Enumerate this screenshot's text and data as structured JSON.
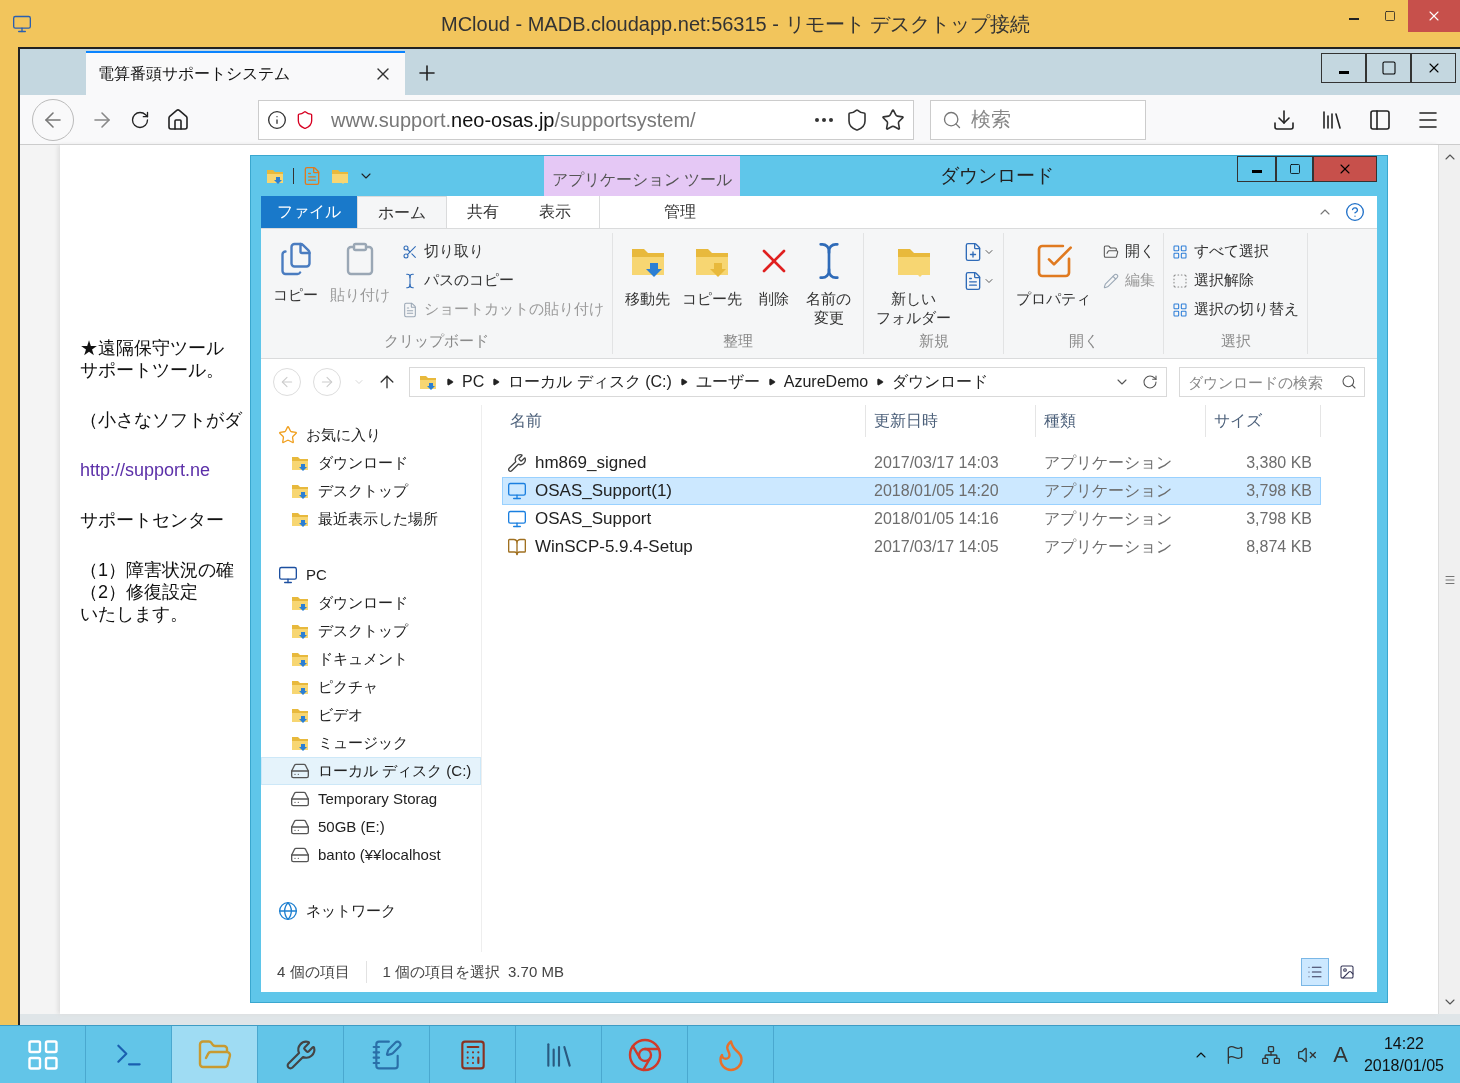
{
  "rdp": {
    "title": "MCloud - MADB.cloudapp.net:56315 - リモート デスクトップ接続"
  },
  "browser": {
    "tabs": [
      {
        "label": "電算番頭サポートシステム",
        "selected": true
      }
    ],
    "url": {
      "prefix": "www.support.",
      "domain": "neo-osas.jp",
      "path": "/supportsystem/"
    },
    "search": {
      "placeholder": "検索"
    }
  },
  "page": {
    "paragraphs": [
      {
        "kind": "text",
        "lines": [
          "★遠隔保守ツール",
          "サポートツール。"
        ]
      },
      {
        "kind": "text",
        "lines": [
          "（小さなソフトがダ"
        ]
      },
      {
        "kind": "link",
        "lines": [
          "http://support.ne"
        ]
      },
      {
        "kind": "text",
        "lines": [
          "サポートセンター"
        ]
      },
      {
        "kind": "text",
        "lines": [
          "（1）障害状況の確",
          "（2）修復設定",
          "いたします。"
        ]
      }
    ]
  },
  "explorer": {
    "title": "ダウンロード",
    "context_tab": "アプリケーション ツール",
    "ribbon_tabs": [
      {
        "label": "ファイル",
        "kind": "file",
        "selected": false
      },
      {
        "label": "ホーム",
        "kind": "tab",
        "selected": true
      },
      {
        "label": "共有",
        "kind": "tab",
        "selected": false
      },
      {
        "label": "表示",
        "kind": "tab",
        "selected": false
      },
      {
        "label": "管理",
        "kind": "context",
        "selected": false
      }
    ],
    "ribbon_groups": [
      {
        "label": "クリップボード",
        "items": [
          {
            "kind": "large",
            "lines": [
              "コピー"
            ],
            "disabled": false
          },
          {
            "kind": "large",
            "lines": [
              "貼り付け"
            ],
            "disabled": true
          },
          {
            "kind": "small",
            "lines": [
              "切り取り"
            ],
            "disabled": false
          },
          {
            "kind": "small",
            "lines": [
              "パスのコピー"
            ],
            "disabled": false
          },
          {
            "kind": "small",
            "lines": [
              "ショートカットの貼り付け"
            ],
            "disabled": true
          }
        ]
      },
      {
        "label": "整理",
        "items": [
          {
            "kind": "large",
            "lines": [
              "移動先"
            ],
            "disabled": false
          },
          {
            "kind": "large",
            "lines": [
              "コピー先"
            ],
            "disabled": false
          },
          {
            "kind": "large",
            "lines": [
              "削除"
            ],
            "disabled": false
          },
          {
            "kind": "large",
            "lines": [
              "名前の",
              "変更"
            ],
            "disabled": false
          }
        ]
      },
      {
        "label": "新規",
        "items": [
          {
            "kind": "large",
            "lines": [
              "新しい",
              "フォルダー"
            ],
            "disabled": false
          },
          {
            "kind": "icon",
            "disabled": false
          },
          {
            "kind": "icon",
            "disabled": false
          }
        ]
      },
      {
        "label": "開く",
        "items": [
          {
            "kind": "large",
            "lines": [
              "プロパティ"
            ],
            "disabled": false
          },
          {
            "kind": "small",
            "lines": [
              "開く"
            ],
            "disabled": false
          },
          {
            "kind": "small",
            "lines": [
              "編集"
            ],
            "disabled": true
          }
        ]
      },
      {
        "label": "選択",
        "items": [
          {
            "kind": "small",
            "lines": [
              "すべて選択"
            ],
            "disabled": false
          },
          {
            "kind": "small",
            "lines": [
              "選択解除"
            ],
            "disabled": false
          },
          {
            "kind": "small",
            "lines": [
              "選択の切り替え"
            ],
            "disabled": false
          }
        ]
      }
    ],
    "back": {
      "disabled": true
    },
    "forward": {
      "disabled": true
    },
    "path": [
      "PC",
      "ローカル ディスク (C:)",
      "ユーザー",
      "AzureDemo",
      "ダウンロード"
    ],
    "search": {
      "placeholder": "ダウンロードの検索"
    },
    "nav": [
      {
        "label": "お気に入り",
        "selected": false,
        "children": [
          {
            "label": "ダウンロード",
            "selected": false
          },
          {
            "label": "デスクトップ",
            "selected": false
          },
          {
            "label": "最近表示した場所",
            "selected": false
          }
        ]
      },
      {
        "label": "PC",
        "selected": false,
        "children": [
          {
            "label": "ダウンロード",
            "selected": false
          },
          {
            "label": "デスクトップ",
            "selected": false
          },
          {
            "label": "ドキュメント",
            "selected": false
          },
          {
            "label": "ピクチャ",
            "selected": false
          },
          {
            "label": "ビデオ",
            "selected": false
          },
          {
            "label": "ミュージック",
            "selected": false
          },
          {
            "label": "ローカル ディスク (C:)",
            "selected": true
          },
          {
            "label": "Temporary Storag",
            "selected": false
          },
          {
            "label": "50GB (E:)",
            "selected": false
          },
          {
            "label": "banto (¥¥localhost",
            "selected": false
          }
        ]
      },
      {
        "label": "ネットワーク",
        "selected": false
      }
    ],
    "columns": [
      "名前",
      "更新日時",
      "種類",
      "サイズ"
    ],
    "files": [
      {
        "name": "hm869_signed",
        "date": "2017/03/17 14:03",
        "type": "アプリケーション",
        "size": "3,380 KB",
        "selected": false
      },
      {
        "name": "OSAS_Support(1)",
        "date": "2018/01/05 14:20",
        "type": "アプリケーション",
        "size": "3,798 KB",
        "selected": true
      },
      {
        "name": "OSAS_Support",
        "date": "2018/01/05 14:16",
        "type": "アプリケーション",
        "size": "3,798 KB",
        "selected": false
      },
      {
        "name": "WinSCP-5.9.4-Setup",
        "date": "2017/03/17 14:05",
        "type": "アプリケーション",
        "size": "8,874 KB",
        "selected": false
      }
    ],
    "status": {
      "count": "4 個の項目",
      "selection": "1 個の項目を選択",
      "size": "3.70 MB"
    },
    "views": [
      {
        "selected": true
      },
      {
        "selected": false
      }
    ]
  },
  "taskbar": {
    "apps": [
      {
        "selected": false
      },
      {
        "selected": false
      },
      {
        "selected": true
      },
      {
        "selected": false
      },
      {
        "selected": false
      },
      {
        "selected": false
      },
      {
        "selected": false
      },
      {
        "selected": false
      },
      {
        "selected": false
      }
    ],
    "ime": "A",
    "time": "14:22",
    "date": "2018/01/05"
  }
}
